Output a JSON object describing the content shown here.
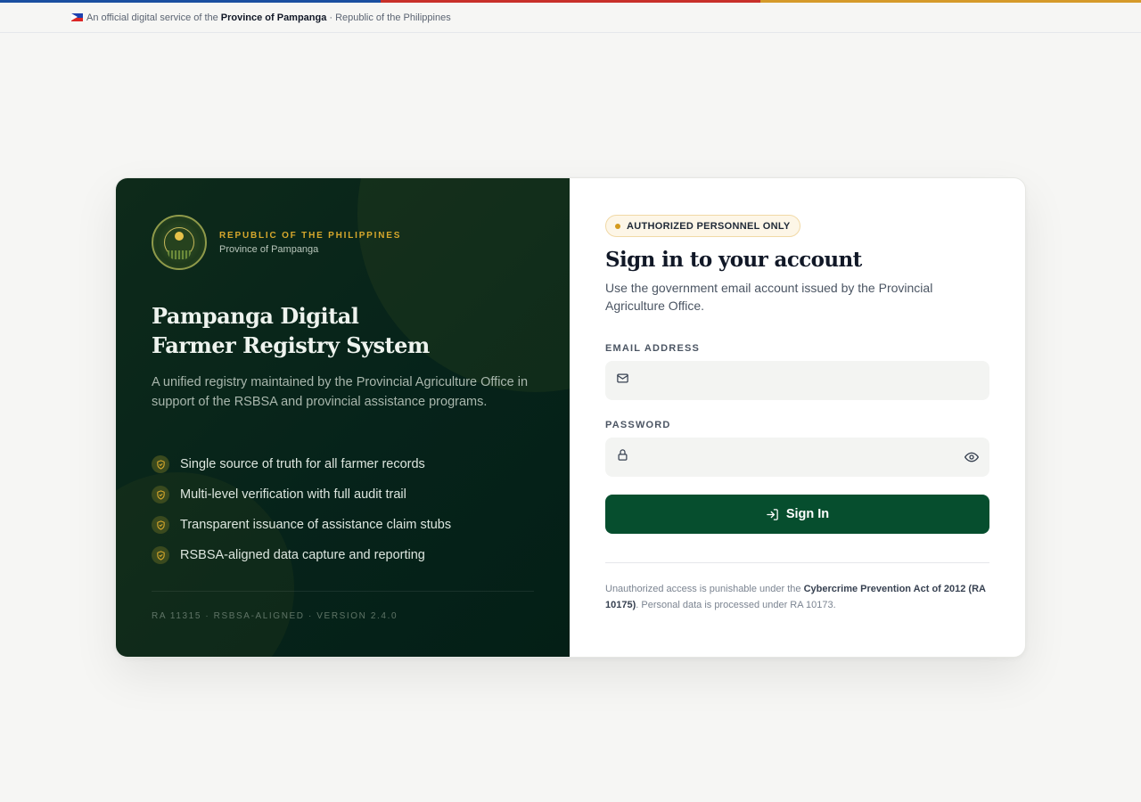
{
  "flag_colors": [
    "#1a4fa0",
    "#c8302a",
    "#d59a2a"
  ],
  "banner": {
    "prefix": "An official digital service of the",
    "province": "Province of Pampanga",
    "suffix": "· Republic of the Philippines"
  },
  "brand": {
    "seal_icon": "provincial-seal",
    "kicker": "REPUBLIC OF THE PHILIPPINES",
    "sub": "Province of Pampanga"
  },
  "hero": {
    "title_line1": "Pampanga Digital",
    "title_line2": "Farmer Registry System",
    "description": "A unified registry maintained by the Provincial Agriculture Office in support of the RSBSA and provincial assistance programs."
  },
  "features": [
    "Single source of truth for all farmer records",
    "Multi-level verification with full audit trail",
    "Transparent issuance of assistance claim stubs",
    "RSBSA-aligned data capture and reporting"
  ],
  "footer_left": "RA 11315 · RSBSA-ALIGNED · VERSION 2.4.0",
  "form": {
    "badge": "AUTHORIZED PERSONNEL ONLY",
    "title": "Sign in to your account",
    "subtitle": "Use the government email account issued by the Provincial Agriculture Office.",
    "email_label": "EMAIL ADDRESS",
    "email_value": "",
    "email_placeholder": "",
    "password_label": "PASSWORD",
    "password_value": "",
    "password_placeholder": "",
    "submit_label": "Sign In"
  },
  "legal": {
    "part1": "Unauthorized access is punishable under the",
    "act": "Cybercrime Prevention Act of 2012 (RA 10175)",
    "part2": ". Personal data is processed under RA 10173."
  },
  "colors": {
    "primary": "#064e2e",
    "accent": "#d6a72c",
    "panel_dark": "#06231a"
  }
}
